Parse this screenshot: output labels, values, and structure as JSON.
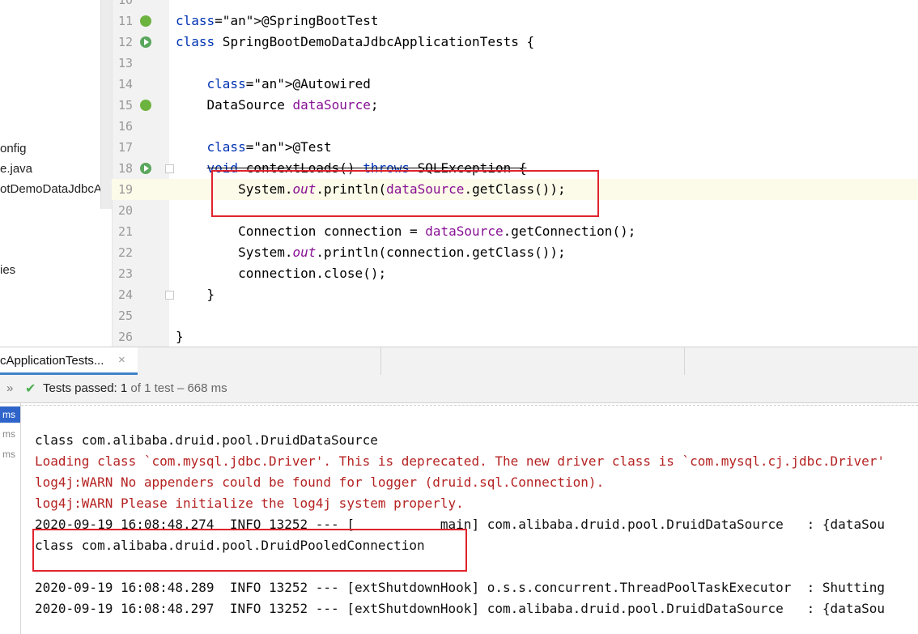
{
  "project_tree": {
    "items": [
      "onfig",
      "e.java",
      "otDemoDataJdbcAp",
      "ies"
    ]
  },
  "editor": {
    "lines": [
      {
        "num": "10",
        "code": ""
      },
      {
        "num": "11",
        "code": "@SpringBootTest",
        "icon": "spring"
      },
      {
        "num": "12",
        "code": "class SpringBootDemoDataJdbcApplicationTests {",
        "icon": "run"
      },
      {
        "num": "13",
        "code": ""
      },
      {
        "num": "14",
        "code": "    @Autowired"
      },
      {
        "num": "15",
        "code": "    DataSource dataSource;",
        "icon": "spring"
      },
      {
        "num": "16",
        "code": ""
      },
      {
        "num": "17",
        "code": "    @Test"
      },
      {
        "num": "18",
        "code": "    void contextLoads() throws SQLException {",
        "icon": "run"
      },
      {
        "num": "19",
        "code": "        System.out.println(dataSource.getClass());"
      },
      {
        "num": "20",
        "code": ""
      },
      {
        "num": "21",
        "code": "        Connection connection = dataSource.getConnection();"
      },
      {
        "num": "22",
        "code": "        System.out.println(connection.getClass());"
      },
      {
        "num": "23",
        "code": "        connection.close();"
      },
      {
        "num": "24",
        "code": "    }"
      },
      {
        "num": "25",
        "code": ""
      },
      {
        "num": "26",
        "code": "}"
      }
    ]
  },
  "run_window": {
    "tab_label": "cApplicationTests...",
    "tab_close": "×",
    "expand_glyph": "»",
    "status_prefix": "Tests passed:",
    "status_count": "1",
    "status_suffix": "of 1 test – 668 ms",
    "test_list": [
      "ms",
      "ms",
      "ms"
    ]
  },
  "console": {
    "lines": [
      {
        "text": "class com.alibaba.druid.pool.DruidDataSource",
        "type": "normal"
      },
      {
        "text": "Loading class `com.mysql.jdbc.Driver'. This is deprecated. The new driver class is `com.mysql.cj.jdbc.Driver'",
        "type": "err"
      },
      {
        "text": "log4j:WARN No appenders could be found for logger (druid.sql.Connection).",
        "type": "err"
      },
      {
        "text": "log4j:WARN Please initialize the log4j system properly.",
        "type": "err"
      },
      {
        "text": "2020-09-19 16:08:48.274  INFO 13252 --- [           main] com.alibaba.druid.pool.DruidDataSource   : {dataSou",
        "type": "normal"
      },
      {
        "text": "class com.alibaba.druid.pool.DruidPooledConnection",
        "type": "normal"
      },
      {
        "text": "",
        "type": "normal"
      },
      {
        "text": "2020-09-19 16:08:48.289  INFO 13252 --- [extShutdownHook] o.s.s.concurrent.ThreadPoolTaskExecutor  : Shutting",
        "type": "normal"
      },
      {
        "text": "2020-09-19 16:08:48.297  INFO 13252 --- [extShutdownHook] com.alibaba.druid.pool.DruidDataSource   : {dataSou",
        "type": "normal"
      }
    ]
  },
  "colors": {
    "annotation": "#9e880d",
    "keyword": "#0033b3",
    "field": "#871094",
    "error_text": "#b52222",
    "highlight_box": "#e0242d",
    "tab_underline": "#4083c9",
    "pass_check": "#4caf50"
  }
}
